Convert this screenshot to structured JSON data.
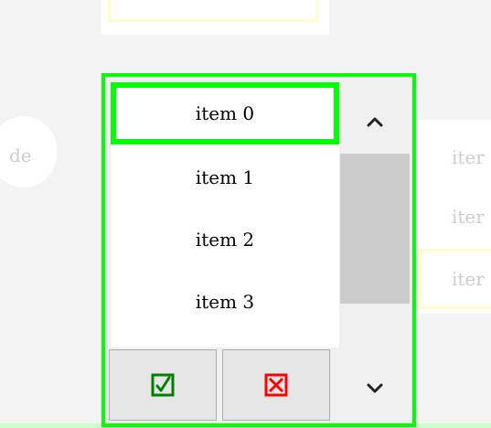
{
  "background": {
    "left_label": "de",
    "right_items": [
      "iter",
      "iter",
      "iter"
    ]
  },
  "picker": {
    "items": [
      {
        "label": "item 0",
        "selected": true
      },
      {
        "label": "item 1",
        "selected": false
      },
      {
        "label": "item 2",
        "selected": false
      },
      {
        "label": "item 3",
        "selected": false
      }
    ],
    "scroll_up_icon": "chevron-up-icon",
    "scroll_down_icon": "chevron-down-icon",
    "confirm_icon": "checkbox-check-icon",
    "cancel_icon": "checkbox-cross-icon"
  },
  "colors": {
    "accent": "#00ff00",
    "confirm": "#008000",
    "cancel": "#ff0000",
    "faded_highlight": "#ffffcc"
  }
}
